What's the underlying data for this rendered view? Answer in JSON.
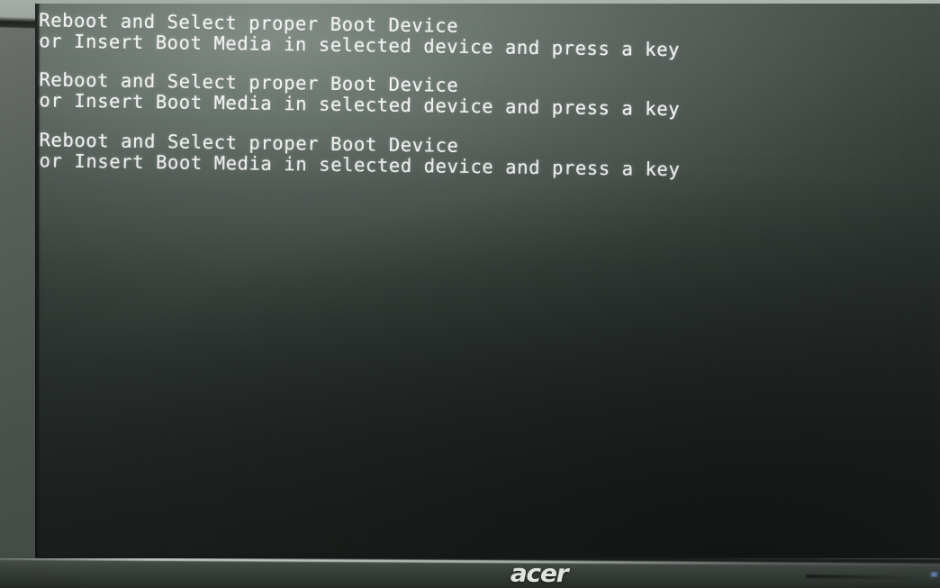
{
  "device": {
    "brand_logo": "acer",
    "type": "monitor"
  },
  "screen": {
    "state": "bios-boot-error",
    "background_color": "#2a312e",
    "text_color": "#f2f4f2",
    "messages": [
      {
        "line1": "Reboot and Select proper Boot Device",
        "line2": "or Insert Boot Media in selected device and press a key"
      },
      {
        "line1": "Reboot and Select proper Boot Device",
        "line2": "or Insert Boot Media in selected device and press a key"
      },
      {
        "line1": "Reboot and Select proper Boot Device",
        "line2": "or Insert Boot Media in selected device and press a key"
      }
    ]
  }
}
